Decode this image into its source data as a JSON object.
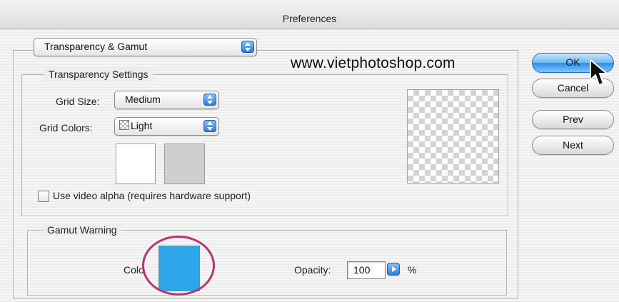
{
  "window": {
    "title": "Preferences"
  },
  "section_popup": {
    "value": "Transparency & Gamut"
  },
  "watermark": {
    "text": "www.vietphotoshop.com"
  },
  "transparency": {
    "title": "Transparency Settings",
    "grid_size_label": "Grid Size:",
    "grid_size_value": "Medium",
    "grid_colors_label": "Grid Colors:",
    "grid_colors_value": "Light",
    "swatch_colors": [
      "#ffffff",
      "#cfcfcf"
    ],
    "video_alpha_label": "Use video alpha (requires hardware support)",
    "video_alpha_checked": false
  },
  "gamut": {
    "title": "Gamut Warning",
    "color_label": "Colo",
    "color_value": "#2ea6ea",
    "highlight_color": "#b83572",
    "opacity_label": "Opacity:",
    "opacity_value": "100",
    "opacity_unit": "%"
  },
  "buttons": {
    "ok": "OK",
    "cancel": "Cancel",
    "prev": "Prev",
    "next": "Next"
  },
  "icons": {
    "cursor": "arrow-cursor-icon",
    "popup_arrows": "popup-arrows-icon",
    "stepper": "right-arrow-icon"
  }
}
